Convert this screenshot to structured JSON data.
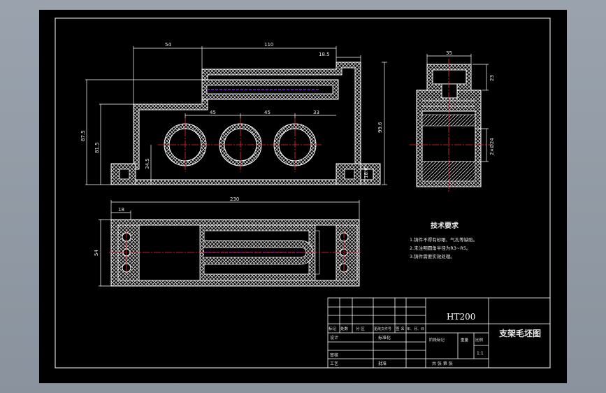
{
  "colors": {
    "background": "#000000",
    "outline": "#ffffff",
    "centerline": "#ff2a2a",
    "section": "#7a1fd0",
    "frame_outer": "#9aa3ad"
  },
  "front_view": {
    "dim_top_left": "54",
    "dim_top_mid": "110",
    "dim_top_right": "18.5",
    "dim_left_1": "87.5",
    "dim_left_2": "81.5",
    "dim_left_3": "34.5",
    "dim_right_1": "99.6",
    "dim_right_2": "18.6",
    "hole_pitch_1": "45",
    "hole_pitch_2": "45",
    "hole_pitch_3": "33"
  },
  "side_view": {
    "dim_top": "35",
    "dim_right_top": "23",
    "dim_right_bottom": "2×Ø24"
  },
  "top_view": {
    "dim_top_total": "230",
    "dim_top_left": "18",
    "dim_left": "54"
  },
  "tech_requirements": {
    "title": "技术要求",
    "items": [
      "1.铸件不得有砂眼、气孔等缺陷。",
      "2.未注明圆角半径为R3~R5。",
      "3.铸件需要实效处理。"
    ]
  },
  "title_block": {
    "material": "HT200",
    "part_name": "支架毛坯图",
    "row_labels": [
      "标记",
      "处数",
      "分 区",
      "更改文件号",
      "签 名",
      "年、月、日"
    ],
    "design": "设计",
    "standardize": "标准化",
    "review": "审核",
    "process": "工艺",
    "approve": "批准",
    "stage_mark": "阶段标记",
    "weight": "重量",
    "scale_label": "比例",
    "scale": "1:1",
    "sheet_info": "共  张  第  张"
  }
}
